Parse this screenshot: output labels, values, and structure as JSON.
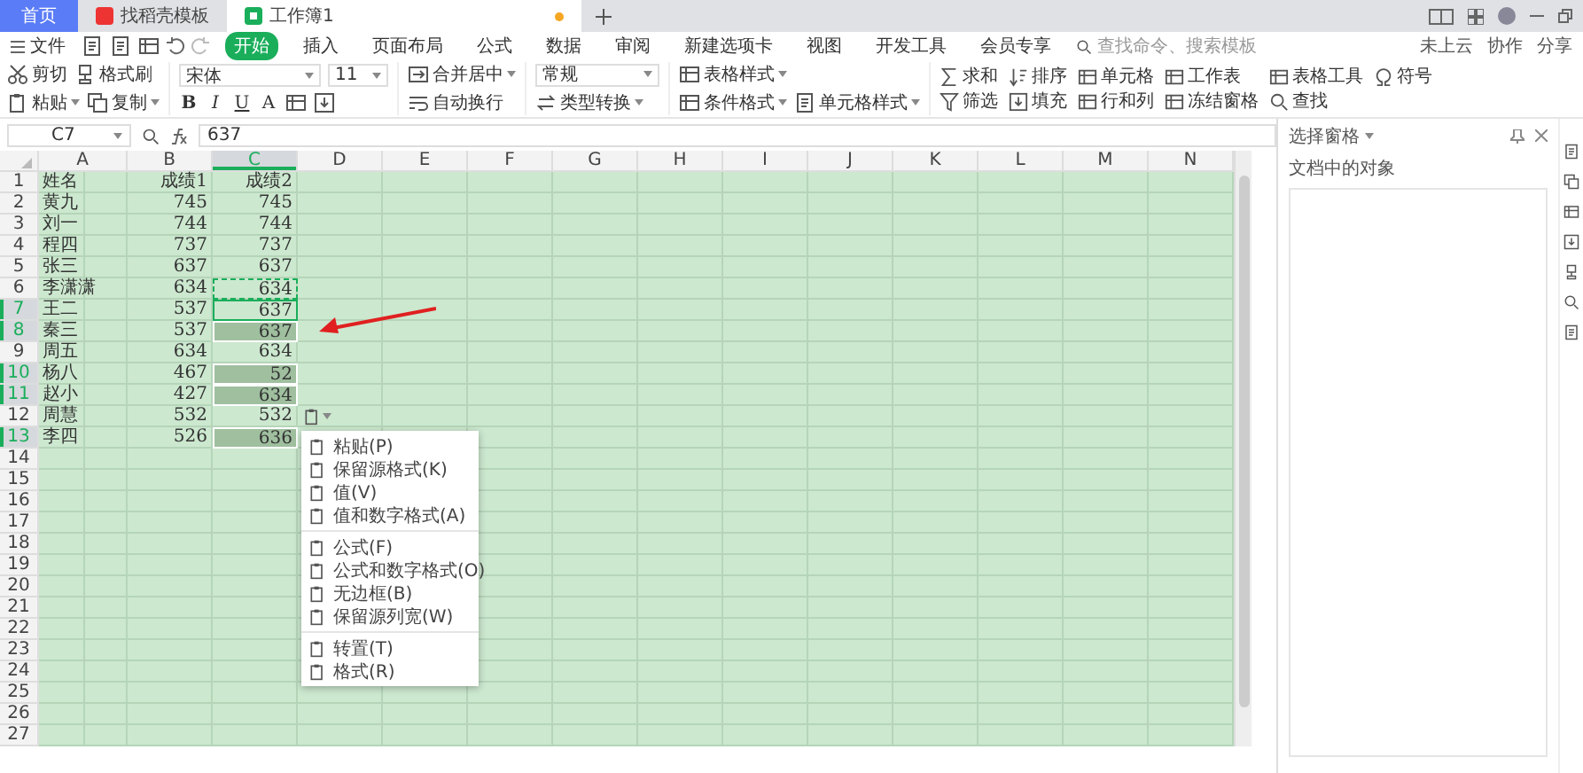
{
  "tabs": [
    {
      "label": "首页",
      "kind": "home",
      "selected": false
    },
    {
      "label": "找稻壳模板",
      "kind": "template",
      "selected": false
    },
    {
      "label": "工作簿1",
      "kind": "sheet",
      "selected": true
    }
  ],
  "menu": {
    "file": "文件",
    "items": [
      {
        "label": "开始",
        "selected": true
      },
      {
        "label": "插入",
        "selected": false
      },
      {
        "label": "页面布局",
        "selected": false
      },
      {
        "label": "公式",
        "selected": false
      },
      {
        "label": "数据",
        "selected": false
      },
      {
        "label": "审阅",
        "selected": false
      },
      {
        "label": "新建选项卡",
        "selected": false
      },
      {
        "label": "视图",
        "selected": false
      },
      {
        "label": "开发工具",
        "selected": false
      },
      {
        "label": "会员专享",
        "selected": false
      }
    ],
    "search": {
      "placeholder": "查找命令、搜索模板"
    },
    "actions": [
      "未上云",
      "协作",
      "分享"
    ]
  },
  "ribbon": {
    "clipboard": {
      "cut": "剪切",
      "paste": "粘贴",
      "copy": "复制",
      "format_painter": "格式刷"
    },
    "font": {
      "name": "宋体",
      "size": "11",
      "styles": [
        "B",
        "I",
        "U",
        "A"
      ]
    },
    "alignment": {
      "merge": "合并居中",
      "wrap": "自动换行"
    },
    "number": {
      "format": "常规",
      "convert": "类型转换"
    },
    "styles": {
      "table_style": "表格样式",
      "conditional": "条件格式",
      "cell_style": "单元格样式"
    },
    "tools": [
      "求和",
      "筛选",
      "排序",
      "填充",
      "单元格",
      "行和列",
      "工作表",
      "冻结窗格",
      "表格工具",
      "查找",
      "符号"
    ]
  },
  "formula_bar": {
    "cell": "C7",
    "value": "637"
  },
  "sheet": {
    "columns": [
      {
        "label": "A",
        "selected": false
      },
      {
        "label": "B",
        "selected": false
      },
      {
        "label": "C",
        "selected": true
      },
      {
        "label": "D",
        "selected": false
      },
      {
        "label": "E",
        "selected": false
      },
      {
        "label": "F",
        "selected": false
      },
      {
        "label": "G",
        "selected": false
      },
      {
        "label": "H",
        "selected": false
      },
      {
        "label": "I",
        "selected": false
      },
      {
        "label": "J",
        "selected": false
      },
      {
        "label": "K",
        "selected": false
      },
      {
        "label": "L",
        "selected": false
      },
      {
        "label": "M",
        "selected": false
      },
      {
        "label": "N",
        "selected": false
      }
    ],
    "rows": [
      {
        "header": "1",
        "selected": false,
        "cells": [
          {
            "text": "姓名",
            "selected": false
          },
          {
            "text": "成绩1",
            "selected": false
          },
          {
            "text": "成绩2",
            "selected": false
          }
        ]
      },
      {
        "header": "2",
        "selected": false,
        "cells": [
          {
            "text": "黄九",
            "selected": false
          },
          {
            "text": "745",
            "selected": false
          },
          {
            "text": "745",
            "selected": false
          }
        ]
      },
      {
        "header": "3",
        "selected": false,
        "cells": [
          {
            "text": "刘一",
            "selected": false
          },
          {
            "text": "744",
            "selected": false
          },
          {
            "text": "744",
            "selected": false
          }
        ]
      },
      {
        "header": "4",
        "selected": false,
        "cells": [
          {
            "text": "程四",
            "selected": false
          },
          {
            "text": "737",
            "selected": false
          },
          {
            "text": "737",
            "selected": false
          }
        ]
      },
      {
        "header": "5",
        "selected": false,
        "cells": [
          {
            "text": "张三",
            "selected": false
          },
          {
            "text": "637",
            "selected": false
          },
          {
            "text": "637",
            "selected": false
          }
        ]
      },
      {
        "header": "6",
        "selected": false,
        "cells": [
          {
            "text": "李潇潇",
            "selected": false
          },
          {
            "text": "634",
            "selected": false
          },
          {
            "text": "634",
            "selected": false,
            "copied": true
          }
        ]
      },
      {
        "header": "7",
        "selected": true,
        "cells": [
          {
            "text": "王二",
            "selected": false
          },
          {
            "text": "537",
            "selected": false
          },
          {
            "text": "637",
            "selected": false,
            "active": true
          }
        ]
      },
      {
        "header": "8",
        "selected": true,
        "cells": [
          {
            "text": "秦三",
            "selected": false
          },
          {
            "text": "537",
            "selected": false
          },
          {
            "text": "637",
            "selected": true
          }
        ]
      },
      {
        "header": "9",
        "selected": false,
        "cells": [
          {
            "text": "周五",
            "selected": false
          },
          {
            "text": "634",
            "selected": false
          },
          {
            "text": "634",
            "selected": false
          }
        ]
      },
      {
        "header": "10",
        "selected": true,
        "cells": [
          {
            "text": "杨八",
            "selected": false
          },
          {
            "text": "467",
            "selected": false
          },
          {
            "text": "52",
            "selected": true
          }
        ]
      },
      {
        "header": "11",
        "selected": true,
        "cells": [
          {
            "text": "赵小",
            "selected": false
          },
          {
            "text": "427",
            "selected": false
          },
          {
            "text": "634",
            "selected": true
          }
        ]
      },
      {
        "header": "12",
        "selected": false,
        "cells": [
          {
            "text": "周慧",
            "selected": false
          },
          {
            "text": "532",
            "selected": false
          },
          {
            "text": "532",
            "selected": false
          }
        ]
      },
      {
        "header": "13",
        "selected": true,
        "cells": [
          {
            "text": "李四",
            "selected": false
          },
          {
            "text": "526",
            "selected": false
          },
          {
            "text": "636",
            "selected": true
          }
        ]
      },
      {
        "header": "14",
        "selected": false,
        "cells": []
      },
      {
        "header": "15",
        "selected": false,
        "cells": []
      },
      {
        "header": "16",
        "selected": false,
        "cells": []
      },
      {
        "header": "17",
        "selected": false,
        "cells": []
      },
      {
        "header": "18",
        "selected": false,
        "cells": []
      },
      {
        "header": "19",
        "selected": false,
        "cells": []
      },
      {
        "header": "20",
        "selected": false,
        "cells": []
      },
      {
        "header": "21",
        "selected": false,
        "cells": []
      },
      {
        "header": "22",
        "selected": false,
        "cells": []
      },
      {
        "header": "23",
        "selected": false,
        "cells": []
      },
      {
        "header": "24",
        "selected": false,
        "cells": []
      },
      {
        "header": "25",
        "selected": false,
        "cells": []
      },
      {
        "header": "26",
        "selected": false,
        "cells": []
      },
      {
        "header": "27",
        "selected": false,
        "cells": []
      }
    ]
  },
  "paste_menu": {
    "groups": [
      [
        "粘贴(P)",
        "保留源格式(K)",
        "值(V)",
        "值和数字格式(A)"
      ],
      [
        "公式(F)",
        "公式和数字格式(O)",
        "无边框(B)",
        "保留源列宽(W)"
      ],
      [
        "转置(T)",
        "格式(R)"
      ]
    ]
  },
  "side_pane": {
    "title": "选择窗格",
    "subtitle": "文档中的对象"
  }
}
